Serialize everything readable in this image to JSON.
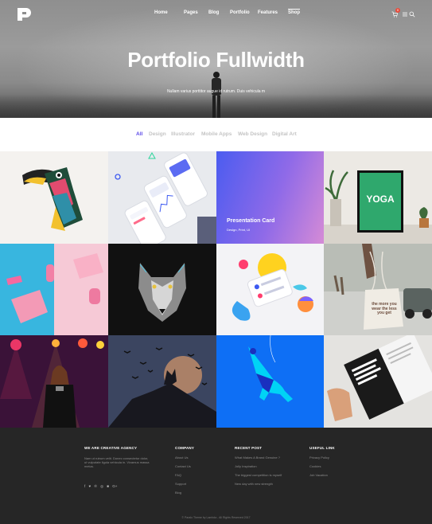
{
  "header": {
    "logo_letter": "P",
    "nav": [
      {
        "label": "Home"
      },
      {
        "label": "Pages"
      },
      {
        "label": "Blog"
      },
      {
        "label": "Portfolio"
      },
      {
        "label": "Features"
      },
      {
        "label": "Shop"
      }
    ],
    "cart_count": "0"
  },
  "hero": {
    "title": "Portfolio Fullwidth",
    "subtitle": "Nullam varius porttitor augue id rutrum. Duis vehicula m"
  },
  "filters": [
    {
      "label": "All"
    },
    {
      "label": "Design"
    },
    {
      "label": "Illustrator"
    },
    {
      "label": "Mobile Apps"
    },
    {
      "label": "Web Design"
    },
    {
      "label": "Digital Art"
    }
  ],
  "portfolio": {
    "card_title": "Presentation Card",
    "card_meta": "Design, Print, UI",
    "yoga_word": "YOGA",
    "bag_text": "the more you wear the less you get"
  },
  "footer": {
    "about": {
      "heading": "WE ARE CREATIVE AGENCY",
      "text": "Nam ut rutrum velit. Donec consectetur dolor, ut vulputate ligula vehicula in. Vivamus massa metus."
    },
    "company": {
      "heading": "COMPANY",
      "links": [
        "About Us",
        "Contact Us",
        "FAQ",
        "Support",
        "Blog"
      ]
    },
    "recent": {
      "heading": "RECENT POST",
      "links": [
        "What Makes A Brand Genuine ?",
        "Jolly Inspiration",
        "The biggest competition is myself",
        "New day with new strength"
      ]
    },
    "useful": {
      "heading": "USEFUL LINK",
      "links": [
        "Privacy Policy",
        "Cookies",
        "Job Vacation"
      ]
    },
    "copyright": "© Paralo Theme by Lambda - All Rights Reserved 2017"
  },
  "colors": {
    "accent": "#5b48e8",
    "footer_bg": "#262626"
  }
}
